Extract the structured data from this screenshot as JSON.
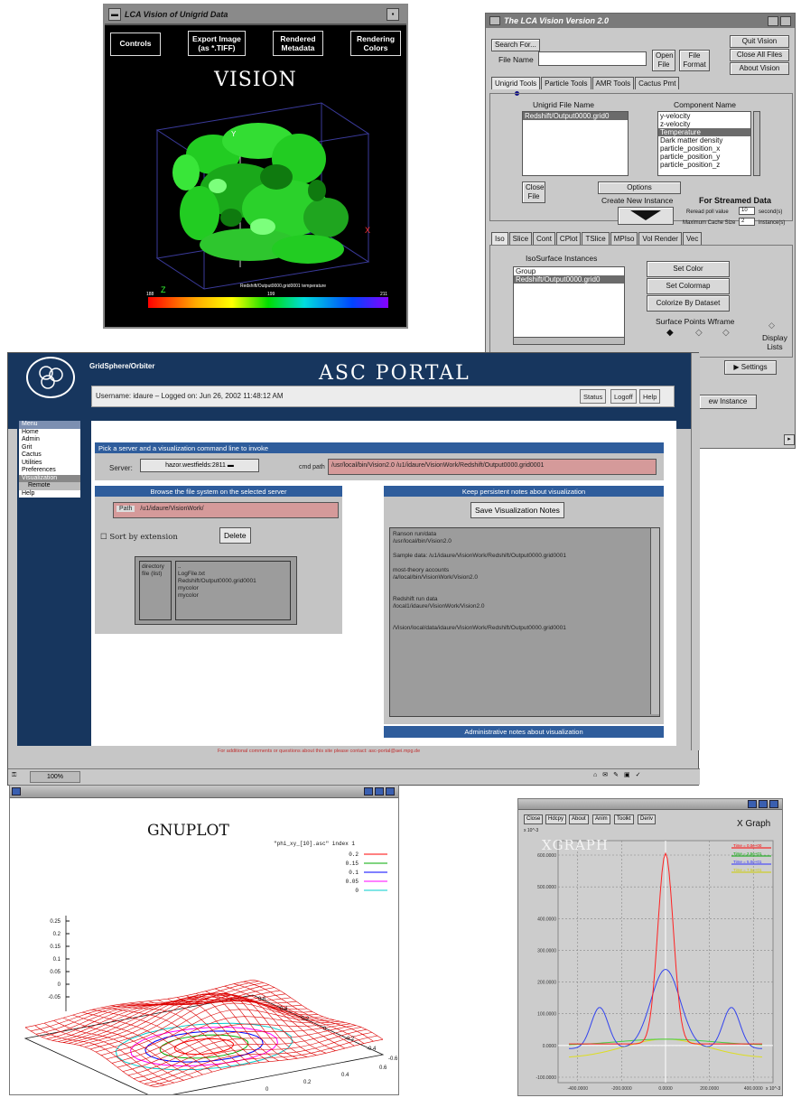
{
  "vision": {
    "title": "LCA Vision of Unigrid Data",
    "buttons": {
      "controls": "Controls",
      "export_l1": "Export Image",
      "export_l2": "(as *.TIFF)",
      "metadata_l1": "Rendered",
      "metadata_l2": "Metadata",
      "colors_l1": "Rendering",
      "colors_l2": "Colors"
    },
    "banner": "VISION",
    "colorbar_caption": "Redshift/Output0000.grid0001  temperature",
    "colorbar_ticks": [
      "188",
      "",
      "199",
      "",
      "211"
    ],
    "axis_labels": {
      "x": "X",
      "y": "Y",
      "z": "Z"
    }
  },
  "lca": {
    "title": "The LCA Vision Version 2.0",
    "search_button": "Search For...",
    "file_name_label": "File Name",
    "open_file_l1": "Open",
    "open_file_l2": "File",
    "file_format_l1": "File",
    "file_format_l2": "Format",
    "quit_button": "Quit Vision",
    "close_all_button": "Close All Files",
    "about_button": "About Vision",
    "tabs": [
      "Unigrid Tools",
      "Particle Tools",
      "AMR Tools",
      "Cactus Pmt"
    ],
    "unigrid_header": "Unigrid File Name",
    "unigrid_files": [
      "Redshift/Output0000.grid0"
    ],
    "component_header": "Component Name",
    "components": [
      "y-velocity",
      "z-velocity",
      "Temperature",
      "Dark matter density",
      "particle_position_x",
      "particle_position_y",
      "particle_position_z"
    ],
    "selected_component": "Temperature",
    "close_file_l1": "Close",
    "close_file_l2": "File",
    "options_button": "Options",
    "create_instance": "Create New Instance",
    "streamed_header": "For Streamed Data",
    "streamed_label1": "Reread poll value",
    "streamed_value1": "10",
    "streamed_unit1": "second(s)",
    "streamed_label2": "Maximum Cache Size",
    "streamed_value2": "2",
    "streamed_unit2": "instance(s)",
    "vis_tabs": [
      "Iso",
      "Slice",
      "Cont",
      "CPlot",
      "TSlice",
      "MPIso",
      "Vol Render",
      "Vec"
    ],
    "iso_header": "IsoSurface Instances",
    "iso_items": [
      "Group",
      "Redshift/Output0000.grid0"
    ],
    "set_color": "Set Color",
    "set_colormap": "Set Colormap",
    "colorize": "Colorize By Dataset",
    "surface_modes": "Surface Points Wframe",
    "display_lists_l1": "Display",
    "display_lists_l2": "Lists",
    "settings_button": "Settings",
    "new_instance_button": "ew Instance"
  },
  "portal": {
    "brand": "GridSphere/Orbiter",
    "title": "ASC PORTAL",
    "user_text": "Username: idaure  –  Logged on: Jun 26, 2002 11:48:12 AM",
    "user_buttons": [
      "Status",
      "Logoff",
      "Help"
    ],
    "menu_header": "Menu",
    "menu_items": [
      "Home",
      "Admin",
      "Grit",
      "Cactus",
      "Utilities",
      "Preferences",
      "Visualization",
      "Remote",
      "Help"
    ],
    "menu_active": "Visualization",
    "menu_sub": "Remote",
    "section_pick": "Pick a server and a visualization command line to invoke",
    "server_label": "Server:",
    "server_value": "hazor.westfields:2811",
    "cmd_label": "cmd path",
    "cmd_value": "/usr/local/bin/Vision2.0  /u1/idaure/VisionWork/Redshift/Output0000.grid0001",
    "browse_header": "Browse the file system on the selected server",
    "path_label": "Path",
    "path_value": "/u1/idaure/VisionWork/",
    "sort_label": "Sort by extension",
    "delete_button": "Delete",
    "file_types": [
      "directory",
      "file (list)"
    ],
    "file_items": [
      "..",
      "LogFile.txt",
      "Redshift/Output0000.grid0001",
      "mycolor",
      "mycolor"
    ],
    "notes_header": "Keep persistent notes about visualization",
    "save_notes_button": "Save Visualization Notes",
    "notes_lines": [
      "Ranson run/data",
      "/usr/local/bin/Vision2.0",
      "",
      "Sample data: /u1/idaure/VisionWork/Redshift/Output0000.grid0001",
      "",
      "most-theory accounts",
      "/a/local/bin/VisionWork/Vision2.0",
      "",
      "",
      "Redshift run data",
      "/local1/idaure/VisionWork/Vision2.0",
      "",
      "",
      "/Vision/local/data/idaure/VisionWork/Redshift/Output0000.grid0001"
    ],
    "admin_header": "Administrative notes about visualization",
    "footer_note": "For additional comments or questions about this site please contact: asc-portal@aei.mpg.de",
    "zoom": "100%"
  },
  "gnuplot": {
    "banner": "GNUPLOT",
    "legend_title": "\"phi_xy_[10].asc\" index 1",
    "legend": [
      {
        "label": "0.2",
        "color": "#ff0000"
      },
      {
        "label": "0.15",
        "color": "#00aa00"
      },
      {
        "label": "0.1",
        "color": "#0000ff"
      },
      {
        "label": "0.05",
        "color": "#ff00ff"
      },
      {
        "label": "0",
        "color": "#00cccc"
      }
    ],
    "z_ticks": [
      "0.25",
      "0.2",
      "0.15",
      "0.1",
      "0.05",
      "0",
      "-0.05"
    ],
    "x_ticks": [
      "-0.6",
      "-0.4",
      "-0.2",
      "0",
      "0.2",
      "0.4",
      "0.6"
    ],
    "y_ticks": [
      "-0.6",
      "-0.4",
      "-0.2",
      "0",
      "0.2",
      "0.4",
      "0.6"
    ]
  },
  "xgraph": {
    "buttons": [
      "Close",
      "Hdcpy",
      "About",
      "Anim",
      "Toolkt",
      "Deriv"
    ],
    "banner": "XGRAPH",
    "title": "X Graph",
    "y_exponent": "x 10^-3",
    "x_exponent": "x 10^-3",
    "y_ticks": [
      "600.0000",
      "500.0000",
      "400.0000",
      "300.0000",
      "200.0000",
      "100.0000",
      "0.0000",
      "-100.0000"
    ],
    "x_ticks": [
      "-400.0000",
      "-200.0000",
      "0.0000",
      "200.0000",
      "400.0000"
    ],
    "legend": [
      {
        "label": "Time = 0.0e+00",
        "color": "#ff0000"
      },
      {
        "label": "Time = 2.5e+01",
        "color": "#00aa00"
      },
      {
        "label": "Time = 5.0e+01",
        "color": "#3333ff"
      },
      {
        "label": "Time = 7.5e+01",
        "color": "#cccc00"
      }
    ],
    "colors": {
      "red": "#ff2222",
      "blue": "#3344ee",
      "yellow": "#dddd22",
      "green": "#44cc44"
    }
  }
}
